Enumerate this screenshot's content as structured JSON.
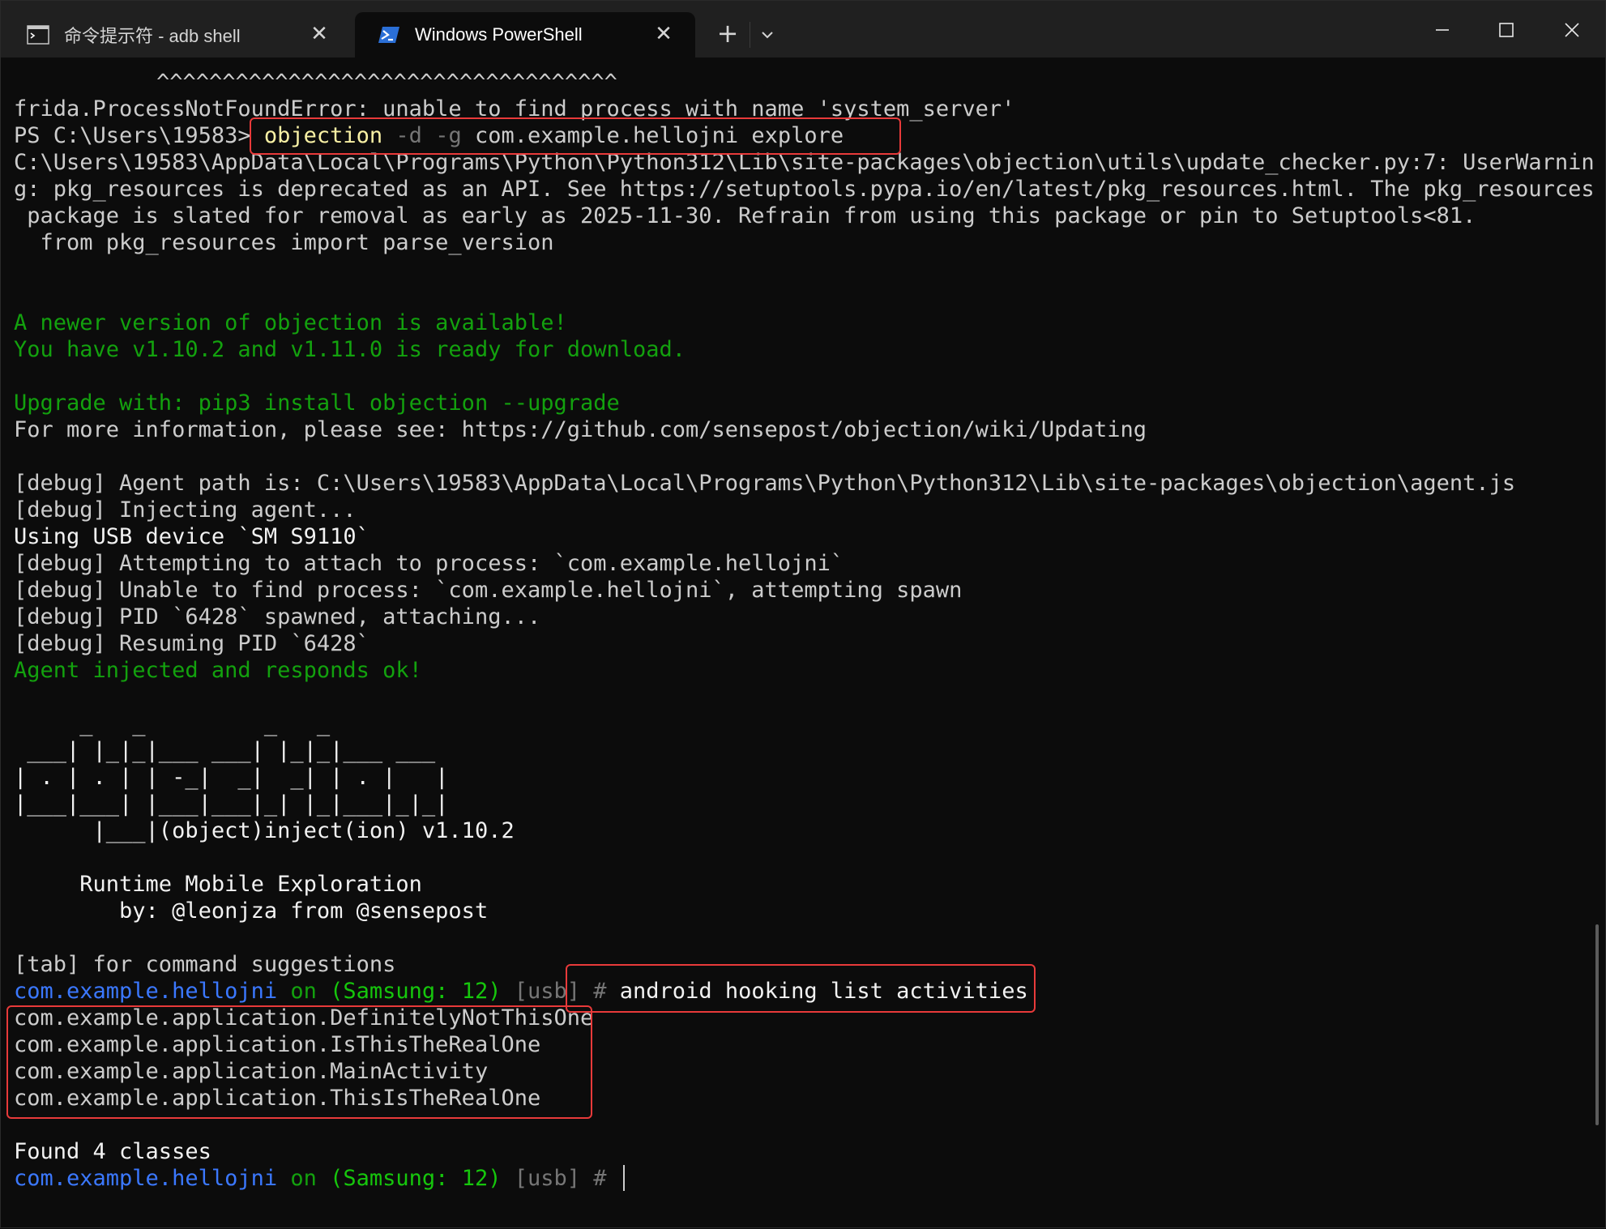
{
  "tabs": [
    {
      "title": "命令提示符 - adb  shell",
      "icon": "cmd-icon",
      "close": "✕"
    },
    {
      "title": "Windows PowerShell",
      "icon": "powershell-icon",
      "close": "✕"
    }
  ],
  "tabbar": {
    "new_tab": "+",
    "dropdown": "chevron-down-icon"
  },
  "window_controls": [
    "minimize-icon",
    "maximize-icon",
    "close-icon"
  ],
  "colors": {
    "background": "#0c0c0c",
    "green": "#13a10e",
    "blue": "#3b78ff",
    "yellow": "#f9f1a5",
    "highlight": "#e83a3a"
  },
  "terminal": {
    "carets": "^^^^^^^^^^^^^^^^^^^^^^^^^^^^^^^^^^^",
    "error": "frida.ProcessNotFoundError: unable to find process with name 'system_server'",
    "prompt1": {
      "ps": "PS C:\\Users\\19583> ",
      "cmd": "objection",
      "flags": " -d -g ",
      "args": "com.example.hellojni explore"
    },
    "warn": [
      "C:\\Users\\19583\\AppData\\Local\\Programs\\Python\\Python312\\Lib\\site-packages\\objection\\utils\\update_checker.py:7: UserWarnin",
      "g: pkg_resources is deprecated as an API. See https://setuptools.pypa.io/en/latest/pkg_resources.html. The pkg_resources",
      " package is slated for removal as early as 2025-11-30. Refrain from using this package or pin to Setuptools<81.",
      "  from pkg_resources import parse_version"
    ],
    "newer": "A newer version of objection is available!",
    "have": "You have v1.10.2 and v1.11.0 is ready for download.",
    "upgrade": "Upgrade with: pip3 install objection --upgrade",
    "moreinfo": "For more information, please see: https://github.com/sensepost/objection/wiki/Updating",
    "debug": [
      "[debug] Agent path is: C:\\Users\\19583\\AppData\\Local\\Programs\\Python\\Python312\\Lib\\site-packages\\objection\\agent.js",
      "[debug] Injecting agent...",
      "Using USB device `SM S9110`",
      "[debug] Attempting to attach to process: `com.example.hellojni`",
      "[debug] Unable to find process: `com.example.hellojni`, attempting spawn",
      "[debug] PID `6428` spawned, attaching...",
      "[debug] Resuming PID `6428`"
    ],
    "injected": "Agent injected and responds ok!",
    "banner": [
      "     _   _         _   _",
      " ___| |_|_|___ ___| |_|_|___ ___",
      "| . | . | | -_|  _|  _| | . |   |",
      "|___|___| |___|___|_| |_|___|_|_|",
      "      |___|(object)inject(ion) v1.10.2"
    ],
    "runtime": "     Runtime Mobile Exploration",
    "by": "        by: @leonjza from @sensepost",
    "tabhelp": "[tab] for command suggestions",
    "prompt": {
      "pkg": "com.example.hellojni",
      "on": " on ",
      "device": "(Samsung: 12)",
      "usb": " [usb] ",
      "hash": "#"
    },
    "command": " android hooking list activities",
    "activities": [
      "com.example.application.DefinitelyNotThisOne",
      "com.example.application.IsThisTheRealOne",
      "com.example.application.MainActivity",
      "com.example.application.ThisIsTheRealOne"
    ],
    "found": "Found 4 classes"
  }
}
